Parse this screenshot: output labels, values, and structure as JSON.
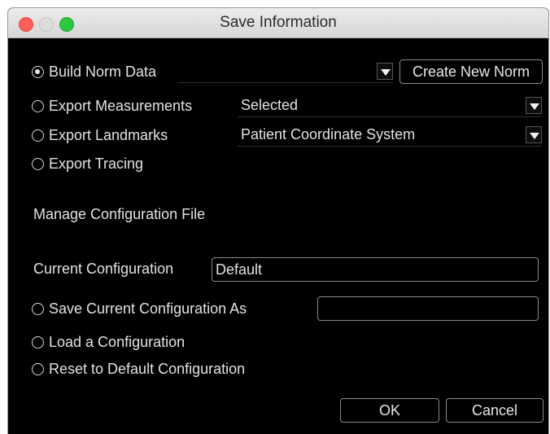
{
  "window": {
    "title": "Save Information"
  },
  "options": {
    "build_norm": "Build Norm Data",
    "export_measurements": "Export Measurements",
    "export_landmarks": "Export Landmarks",
    "export_tracing": "Export Tracing"
  },
  "norm_select": {
    "value": ""
  },
  "create_norm_label": "Create New Norm",
  "measurements_select": {
    "value": "Selected"
  },
  "landmarks_select": {
    "value": "Patient Coordinate System"
  },
  "config": {
    "section_title": "Manage Configuration File",
    "current_label": "Current Configuration",
    "current_value": "Default",
    "save_as_label": "Save Current Configuration As",
    "save_as_value": "",
    "load_label": "Load a Configuration",
    "reset_label": "Reset to Default Configuration"
  },
  "ok_label": "OK",
  "cancel_label": "Cancel"
}
